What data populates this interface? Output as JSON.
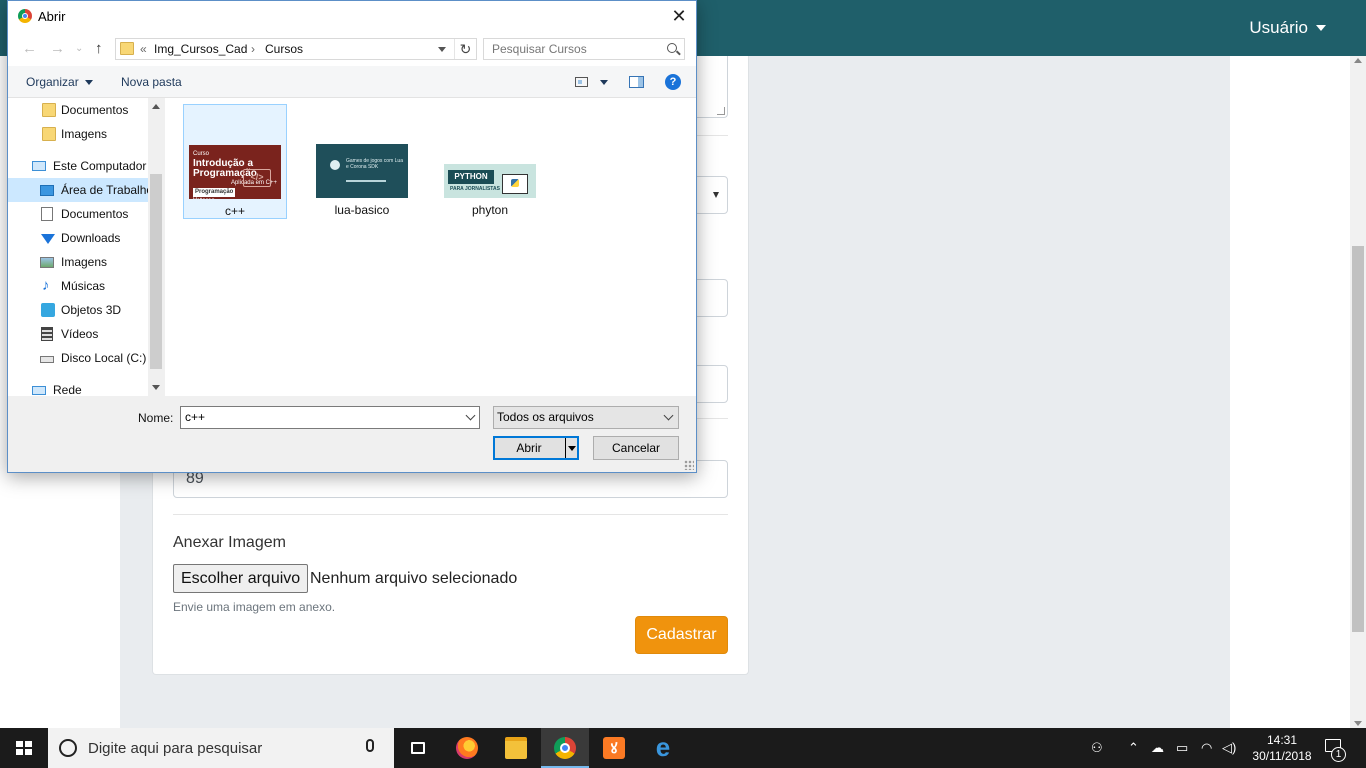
{
  "header": {
    "user_menu_label": "Usuário"
  },
  "form": {
    "input_value": "89",
    "image_label": "Anexar Imagem",
    "choose_file_label": "Escolher arquivo",
    "no_file_text": "Nenhum arquivo selecionado",
    "help_text": "Envie uma imagem em anexo.",
    "submit_label": "Cadastrar",
    "accent_color": "#f0930d"
  },
  "dialog": {
    "title": "Abrir",
    "close_glyph": "✕",
    "address": {
      "prefix": "«",
      "segments": [
        "Img_Cursos_Cad",
        "Cursos"
      ],
      "separator": "›"
    },
    "search_placeholder": "Pesquisar Cursos",
    "organize_label": "Organizar",
    "new_folder_label": "Nova pasta",
    "help_glyph": "?",
    "nav_items": [
      {
        "label": "Documentos",
        "icon": "folder-icon"
      },
      {
        "label": "Imagens",
        "icon": "folder-icon"
      },
      {
        "label": "Este Computador",
        "icon": "computer-icon"
      },
      {
        "label": "Área de Trabalho",
        "icon": "desktop-icon"
      },
      {
        "label": "Documentos",
        "icon": "documents-icon"
      },
      {
        "label": "Downloads",
        "icon": "download-icon"
      },
      {
        "label": "Imagens",
        "icon": "pictures-icon"
      },
      {
        "label": "Músicas",
        "icon": "music-icon"
      },
      {
        "label": "Objetos 3D",
        "icon": "objects-3d-icon"
      },
      {
        "label": "Vídeos",
        "icon": "videos-icon"
      },
      {
        "label": "Disco Local (C:)",
        "icon": "disk-icon"
      },
      {
        "label": "Rede",
        "icon": "network-icon"
      }
    ],
    "files": [
      {
        "name": "c++",
        "thumb_title_small": "Curso",
        "thumb_title": "Introdução a Programação",
        "thumb_sub": "Aplicada em C++",
        "thumb_lesson": "Aula 8: Vetores",
        "thumb_code": "</>",
        "thumb_brand": "Programação"
      },
      {
        "name": "lua-basico",
        "thumb_text": "Games de jogos com Lua e Corona SDK"
      },
      {
        "name": "phyton",
        "thumb_title": "PYTHON",
        "thumb_sub": "PARA JORNALISTAS"
      }
    ],
    "name_label": "Nome:",
    "name_value": "c++",
    "file_type": "Todos os arquivos",
    "open_label": "Abrir",
    "cancel_label": "Cancelar"
  },
  "taskbar": {
    "search_placeholder": "Digite aqui para pesquisar",
    "time": "14:31",
    "date": "30/11/2018",
    "notification_count": "1",
    "apps": [
      "task-view-icon",
      "firefox-icon",
      "file-explorer-icon",
      "chrome-icon",
      "xampp-icon",
      "edge-icon"
    ],
    "xampp_glyph": "ꙋ",
    "edge_glyph": "e"
  }
}
